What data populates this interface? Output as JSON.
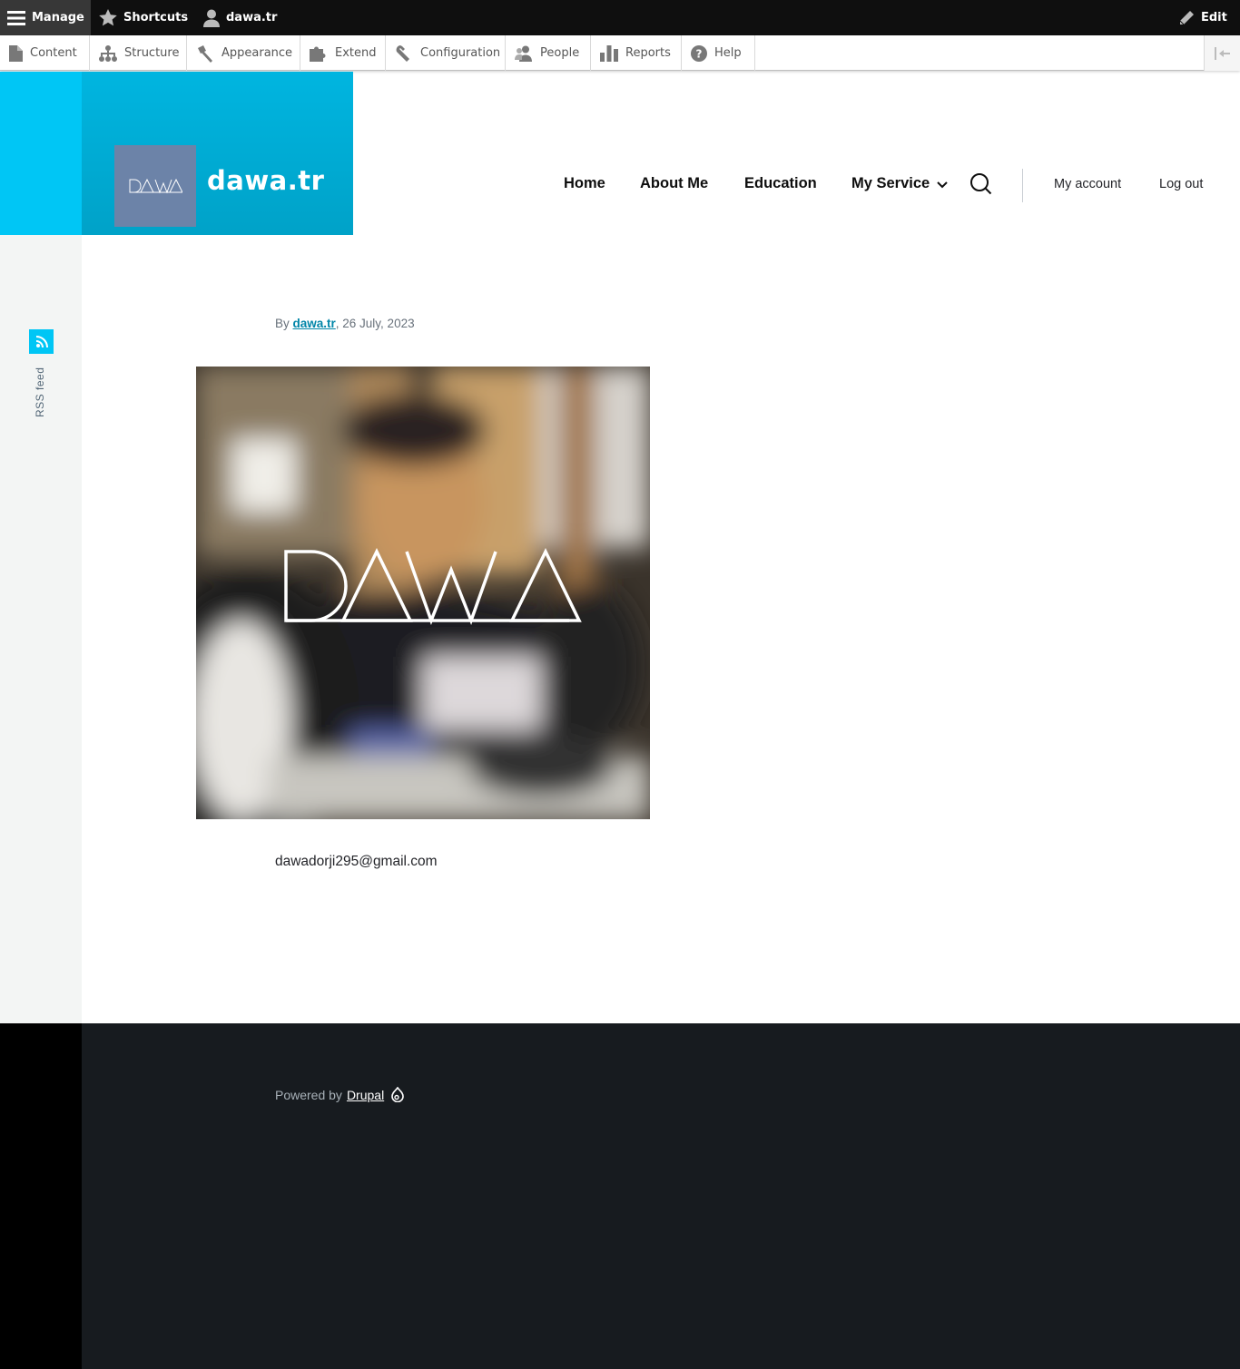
{
  "admin_bar": {
    "manage": "Manage",
    "shortcuts": "Shortcuts",
    "user": "dawa.tr",
    "edit": "Edit"
  },
  "tray": {
    "items": [
      {
        "label": "Content",
        "icon": "file-icon"
      },
      {
        "label": "Structure",
        "icon": "sitemap-icon"
      },
      {
        "label": "Appearance",
        "icon": "paintbrush-icon"
      },
      {
        "label": "Extend",
        "icon": "puzzle-icon"
      },
      {
        "label": "Configuration",
        "icon": "wrench-icon"
      },
      {
        "label": "People",
        "icon": "people-icon"
      },
      {
        "label": "Reports",
        "icon": "bar-chart-icon"
      },
      {
        "label": "Help",
        "icon": "help-icon"
      }
    ]
  },
  "site": {
    "logo_text": "DAWA",
    "name": "dawa.tr"
  },
  "nav": {
    "items": [
      "Home",
      "About Me",
      "Education",
      "My Service"
    ],
    "account": "My account",
    "logout": "Log out"
  },
  "sidebar": {
    "rss_label": "RSS feed"
  },
  "article": {
    "by": "By ",
    "author": "dawa.tr",
    "date": ", 26 July, 2023",
    "image_watermark": "DAWA",
    "email": "dawadorji295@gmail.com"
  },
  "footer": {
    "powered_by": "Powered by",
    "drupal": "Drupal"
  },
  "colors": {
    "brand_cyan": "#00c6f5",
    "logo_box": "#6c83a8",
    "link": "#0085a8",
    "footer_bg": "#171b1f"
  }
}
